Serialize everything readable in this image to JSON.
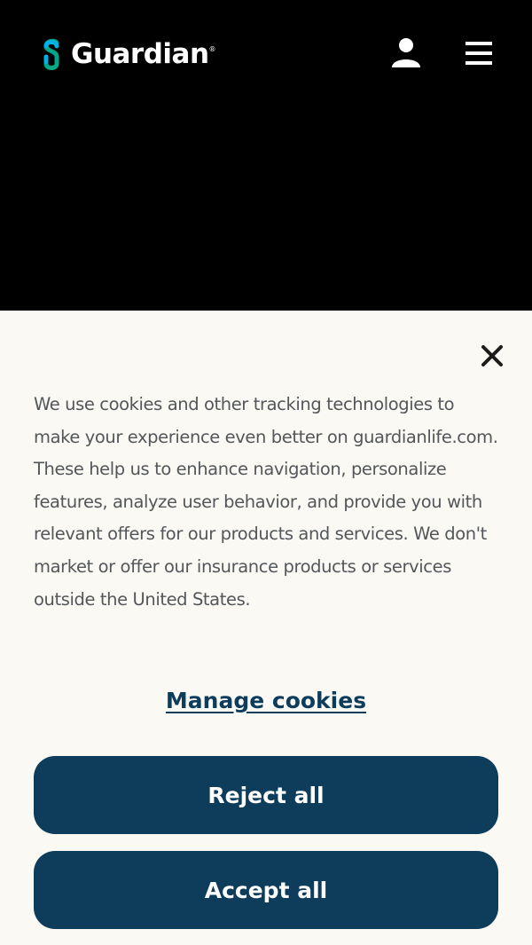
{
  "header": {
    "logo_text": "Guardian",
    "logo_reg": "®",
    "user_icon": "user-icon",
    "menu_icon": "hamburger-menu-icon"
  },
  "cookie_banner": {
    "close_icon": "close-icon",
    "message": "We use cookies and other tracking technologies to make your experience even better on guardianlife.com. These help us to enhance navigation, personalize features, analyze user behavior, and provide you with relevant offers for our products and services. We don't market or offer our insurance products or services outside the United States.",
    "manage_label": "Manage cookies",
    "reject_label": "Reject all",
    "accept_label": "Accept all"
  },
  "colors": {
    "header_bg": "#000000",
    "panel_bg": "#faf9f4",
    "button_bg": "#0e3d5c",
    "logo_green": "#00a887",
    "logo_blue": "#00b2e3",
    "text": "#53565a"
  }
}
